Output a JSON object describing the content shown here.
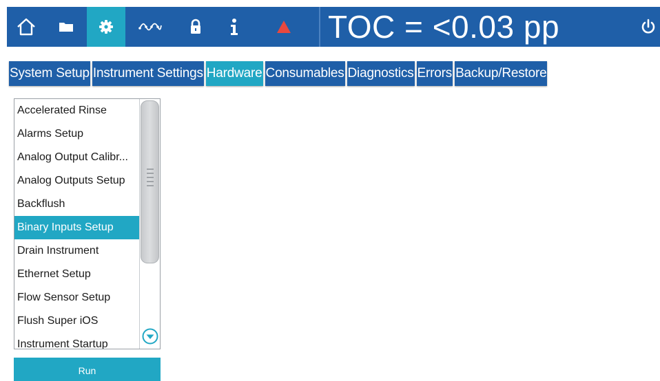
{
  "app": {
    "toc_readout": "TOC = <0.03 pp"
  },
  "nav": {
    "buttons": [
      {
        "icon": "home-icon"
      },
      {
        "icon": "folder-icon"
      },
      {
        "icon": "gear-icon",
        "active": true
      },
      {
        "icon": "trend-icon"
      },
      {
        "icon": "lock-icon"
      },
      {
        "icon": "info-icon"
      },
      {
        "icon": "warning-icon"
      }
    ],
    "power_icon": "power-icon"
  },
  "tabs": [
    {
      "label": "System Setup"
    },
    {
      "label": "Instrument Settings"
    },
    {
      "label": "Hardware",
      "active": true
    },
    {
      "label": "Consumables"
    },
    {
      "label": "Diagnostics"
    },
    {
      "label": "Errors"
    },
    {
      "label": "Backup/Restore"
    }
  ],
  "list": {
    "items": [
      "Accelerated Rinse",
      "Alarms Setup",
      "Analog Output Calibr...",
      "Analog Outputs Setup",
      "Backflush",
      "Binary Inputs Setup",
      "Drain Instrument",
      "Ethernet Setup",
      "Flow Sensor Setup",
      "Flush Super iOS",
      "Instrument Startup"
    ],
    "selected_index": 5
  },
  "run_button": {
    "label": "Run"
  },
  "colors": {
    "primary": "#1f5fa8",
    "accent": "#21a7c4",
    "warning": "#e8483f"
  }
}
